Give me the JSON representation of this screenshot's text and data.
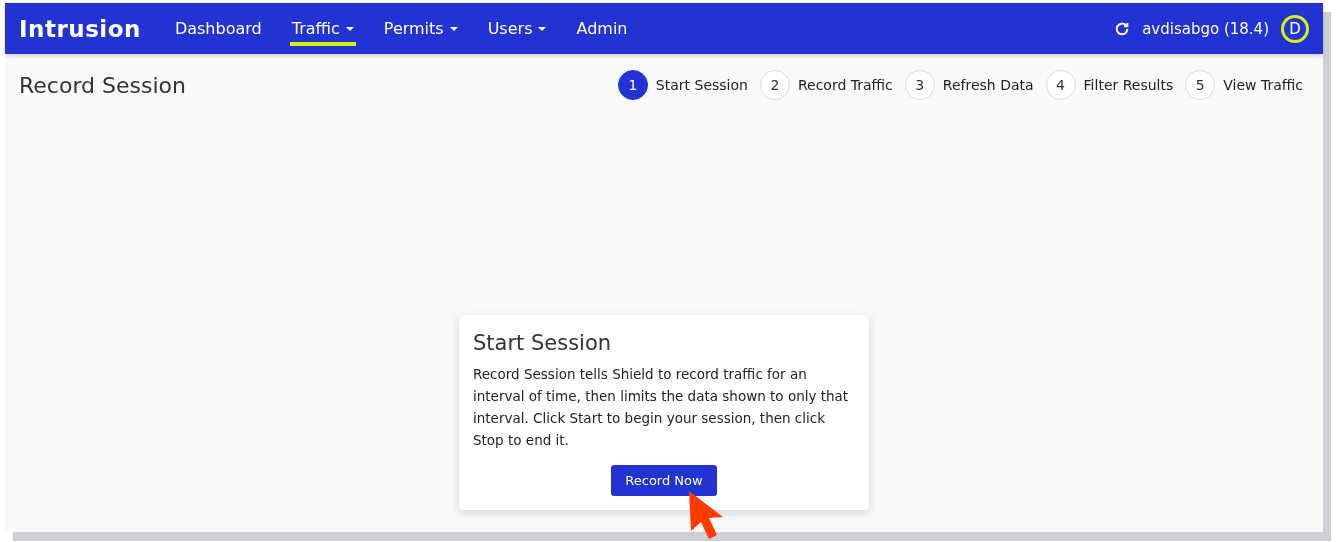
{
  "navbar": {
    "logo": "Intrusion",
    "items": [
      {
        "label": "Dashboard",
        "has_menu": false,
        "selected": false
      },
      {
        "label": "Traffic",
        "has_menu": true,
        "selected": true
      },
      {
        "label": "Permits",
        "has_menu": true,
        "selected": false
      },
      {
        "label": "Users",
        "has_menu": true,
        "selected": false
      },
      {
        "label": "Admin",
        "has_menu": false,
        "selected": false
      }
    ],
    "user": "avdisabgo (18.4)",
    "avatar": "D"
  },
  "page_title": "Record Session",
  "steps": [
    {
      "number": "1",
      "label": "Start Session",
      "selected": true
    },
    {
      "number": "2",
      "label": "Record Traffic",
      "selected": false
    },
    {
      "number": "3",
      "label": "Refresh Data",
      "selected": false
    },
    {
      "number": "4",
      "label": "Filter Results",
      "selected": false
    },
    {
      "number": "5",
      "label": "View Traffic",
      "selected": false
    }
  ],
  "card": {
    "title": "Start Session",
    "text": "Record Session tells Shield to record traffic for an interval of time, then limits the data shown to only that interval. Click Start to begin your session, then click Stop to end it.",
    "button": "Record Now"
  }
}
